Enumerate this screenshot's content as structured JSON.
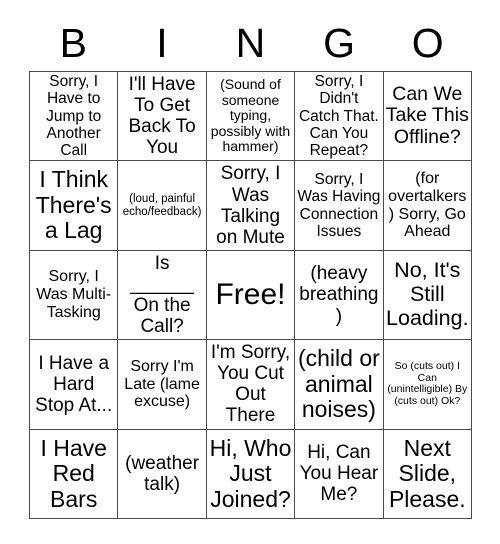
{
  "card": {
    "title": "BINGO",
    "header_letters": [
      "B",
      "I",
      "N",
      "G",
      "O"
    ],
    "free_space_index": 12,
    "colors": {
      "text": "#000000",
      "grid_line": "#4a4a4a",
      "background": "#ffffff"
    },
    "grid": {
      "columns": 5,
      "rows": 5
    },
    "cells": [
      {
        "id": "b1",
        "text": "Sorry, I Have to Jump to Another Call",
        "size": "md"
      },
      {
        "id": "i1",
        "text": "I'll Have To Get Back To You",
        "size": "lg"
      },
      {
        "id": "n1",
        "text": "(Sound of someone typing, possibly with hammer)",
        "size": "sm"
      },
      {
        "id": "g1",
        "text": "Sorry, I Didn't Catch That. Can You Repeat?",
        "size": "md"
      },
      {
        "id": "o1",
        "text": "Can We Take This Offline?",
        "size": "xl"
      },
      {
        "id": "b2",
        "text": "I Think There's a Lag",
        "size": "xl"
      },
      {
        "id": "i2",
        "text": "(loud, painful echo/feedback)",
        "size": "xs"
      },
      {
        "id": "n2",
        "text": "Sorry, I Was Talking on Mute",
        "size": "lg"
      },
      {
        "id": "g2",
        "text": "Sorry, I Was Having Connection Issues",
        "size": "md"
      },
      {
        "id": "o2",
        "text": "(for overtalkers) Sorry, Go Ahead",
        "size": "md"
      },
      {
        "id": "b3",
        "text": "Sorry, I Was Multi-Tasking",
        "size": "md"
      },
      {
        "id": "i3",
        "text": "Is ______ On the Call?",
        "size": "xl"
      },
      {
        "id": "n3",
        "text": "Free!",
        "size": "xxl"
      },
      {
        "id": "g3",
        "text": "(heavy breathing)",
        "size": "lg"
      },
      {
        "id": "o3",
        "text": "No, It's Still Loading.",
        "size": "xl"
      },
      {
        "id": "b4",
        "text": "I Have a Hard Stop At...",
        "size": "lg"
      },
      {
        "id": "i4",
        "text": "Sorry I'm Late (lame excuse)",
        "size": "md"
      },
      {
        "id": "n4",
        "text": "I'm Sorry, You Cut Out There",
        "size": "lg"
      },
      {
        "id": "g4",
        "text": "(child or animal noises)",
        "size": "xl"
      },
      {
        "id": "o4",
        "text": "So (cuts out) I Can (unintelligible) By (cuts out) Ok?",
        "size": "xxs"
      },
      {
        "id": "b5",
        "text": "I Have Red Bars",
        "size": "xl"
      },
      {
        "id": "i5",
        "text": "(weather talk)",
        "size": "lg"
      },
      {
        "id": "n5",
        "text": "Hi, Who Just Joined?",
        "size": "xl"
      },
      {
        "id": "g5",
        "text": "Hi, Can You Hear Me?",
        "size": "lg"
      },
      {
        "id": "o5",
        "text": "Next Slide, Please.",
        "size": "xl"
      }
    ]
  }
}
